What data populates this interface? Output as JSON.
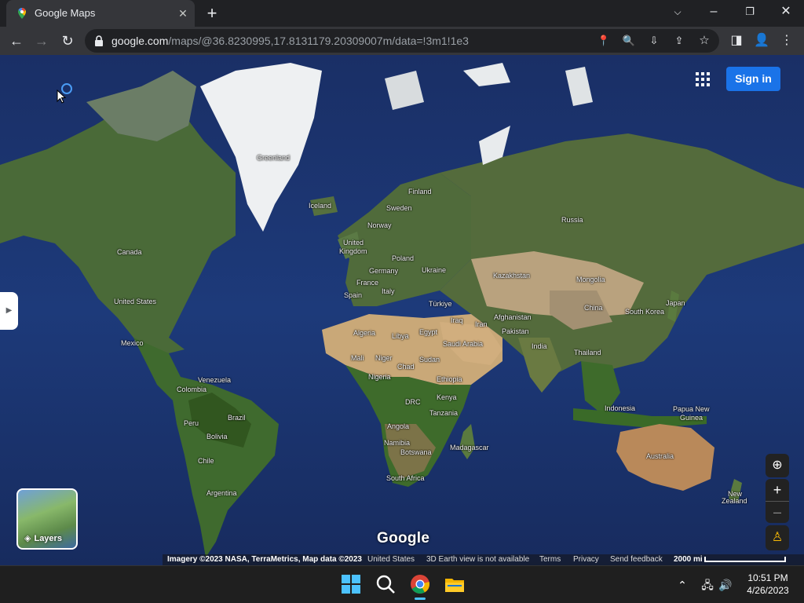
{
  "browser": {
    "tab_title": "Google Maps",
    "url_host": "google.com",
    "url_path": "/maps/@36.8230995,17.8131179.20309007m/data=!3m1!1e3"
  },
  "map": {
    "signin_label": "Sign in",
    "layers_label": "Layers",
    "google_logo": "Google",
    "labels": {
      "greenland": "Greenland",
      "iceland": "Iceland",
      "finland": "Finland",
      "sweden": "Sweden",
      "norway": "Norway",
      "uk1": "United",
      "uk2": "Kingdom",
      "poland": "Poland",
      "germany": "Germany",
      "ukraine": "Ukraine",
      "france": "France",
      "italy": "Italy",
      "spain": "Spain",
      "turkiye": "Türkiye",
      "russia": "Russia",
      "kazakhstan": "Kazakhstan",
      "mongolia": "Mongolia",
      "china": "China",
      "japan": "Japan",
      "southkorea": "South Korea",
      "afghanistan": "Afghanistan",
      "pakistan": "Pakistan",
      "iraq": "Iraq",
      "iran": "Iran",
      "india": "India",
      "thailand": "Thailand",
      "indonesia": "Indonesia",
      "png1": "Papua New",
      "png2": "Guinea",
      "australia": "Australia",
      "nz1": "New",
      "nz2": "Zealand",
      "algeria": "Algeria",
      "libya": "Libya",
      "egypt": "Egypt",
      "saudi": "Saudi Arabia",
      "mali": "Mali",
      "niger": "Niger",
      "chad": "Chad",
      "sudan": "Sudan",
      "nigeria": "Nigeria",
      "ethiopia": "Ethiopia",
      "kenya": "Kenya",
      "drc": "DRC",
      "tanzania": "Tanzania",
      "angola": "Angola",
      "namibia": "Namibia",
      "botswana": "Botswana",
      "madagascar": "Madagascar",
      "southafrica": "South Africa",
      "canada": "Canada",
      "us": "United States",
      "mexico": "Mexico",
      "venezuela": "Venezuela",
      "colombia": "Colombia",
      "brazil": "Brazil",
      "peru": "Peru",
      "bolivia": "Bolivia",
      "chile": "Chile",
      "argentina": "Argentina"
    },
    "footer": {
      "imagery": "Imagery ©2023 NASA, TerraMetrics, Map data ©2023",
      "region": "United States",
      "earth_view": "3D Earth view is not available",
      "terms": "Terms",
      "privacy": "Privacy",
      "feedback": "Send feedback",
      "scale": "2000 mi"
    }
  },
  "taskbar": {
    "time": "10:51 PM",
    "date": "4/26/2023"
  },
  "colors": {
    "ocean": "#1c3470",
    "land": "#4f6b3a",
    "desert": "#c9a878",
    "ice": "#f2f4f6",
    "accent": "#1a73e8"
  }
}
